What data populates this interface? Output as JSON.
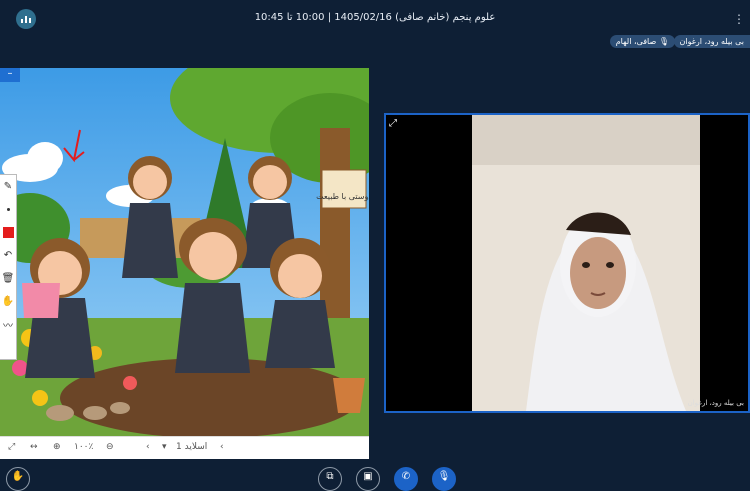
{
  "header": {
    "title": "علوم پنجم (خانم صافی) 1405/02/16 | 10:00 تا 10:45",
    "app_logo_icon": "bar-chart-icon",
    "menu_icon": "vertical-dots-icon"
  },
  "participants_chips": [
    {
      "label": "بی بیله رود، ارغوان"
    },
    {
      "label": "صافی، الهام"
    }
  ],
  "slide": {
    "image_caption": "دوستی با طبیعت",
    "tools": [
      "pencil-icon",
      "dot-size-icon",
      "color-swatch",
      "undo-icon",
      "trash-icon",
      "hand-icon",
      "chart-icon"
    ],
    "toolbar": {
      "zoom": "۱۰۰٪",
      "slide_label": "اسلاید 1"
    }
  },
  "video": {
    "participant_name": "بی بیله رود، ارغوان"
  },
  "colors": {
    "background": "#0e1f35",
    "accent": "#1c63c7",
    "chip": "#2c4d74"
  }
}
